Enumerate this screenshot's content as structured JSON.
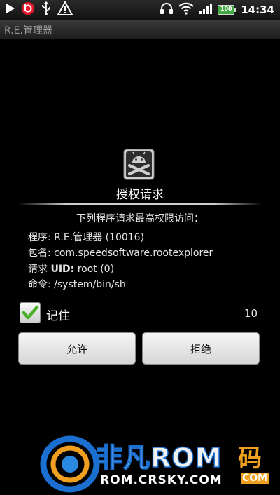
{
  "status_bar": {
    "time": "14:34",
    "battery_level": "100",
    "icons": [
      "play-icon",
      "beats-icon",
      "usb-icon",
      "warning-icon",
      "headset-icon",
      "wifi-icon",
      "signal-icon",
      "battery-icon"
    ]
  },
  "app_title": "R.E.管理器",
  "dialog": {
    "title": "授权请求",
    "message": "下列程序请求最高权限访问：",
    "program_label": "程序:",
    "program_value": "R.E.管理器 (10016)",
    "package_label": "包名:",
    "package_value": "com.speedsoftware.rootexplorer",
    "uid_label_prefix": "请求",
    "uid_label_bold": "UID:",
    "uid_value": "root (0)",
    "command_label": "命令:",
    "command_value": "/system/bin/sh",
    "remember_label": "记住",
    "remember_checked": true,
    "countdown": "10",
    "allow_button": "允许",
    "deny_button": "拒绝"
  },
  "watermark": {
    "text_main": "非凡ROM",
    "text_side": "码",
    "text_url": "ROM.CRSKY.COM",
    "text_com": "COM"
  },
  "colors": {
    "background": "#000000",
    "checkmark": "#4caf2a",
    "watermark_blue": "#1a6fd0",
    "watermark_orange": "#f0a020"
  }
}
